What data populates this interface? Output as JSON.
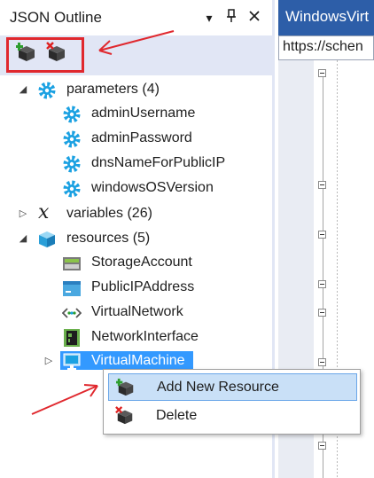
{
  "outline_panel": {
    "title": "JSON Outline",
    "title_buttons": [
      "dropdown-icon",
      "pin-icon",
      "close-icon"
    ],
    "toolbar": {
      "buttons": [
        {
          "icon": "add-resource-icon"
        },
        {
          "icon": "delete-resource-icon"
        }
      ]
    },
    "tree": {
      "parameters": {
        "label": "parameters (4)",
        "children": [
          "adminUsername",
          "adminPassword",
          "dnsNameForPublicIP",
          "windowsOSVersion"
        ]
      },
      "variables": {
        "label": "variables (26)"
      },
      "resources": {
        "label": "resources (5)",
        "children": [
          "StorageAccount",
          "PublicIPAddress",
          "VirtualNetwork",
          "NetworkInterface",
          "VirtualMachine"
        ]
      }
    }
  },
  "context_menu": {
    "items": [
      {
        "label": "Add New Resource"
      },
      {
        "label": "Delete"
      }
    ]
  },
  "editor": {
    "tab_title": "WindowsVirt",
    "url": "https://schen"
  },
  "colors": {
    "annotation": "#e0282e",
    "selection": "#3399ff",
    "menu_hover": "#c9e0f7",
    "tab_active": "#2d5ea8"
  }
}
